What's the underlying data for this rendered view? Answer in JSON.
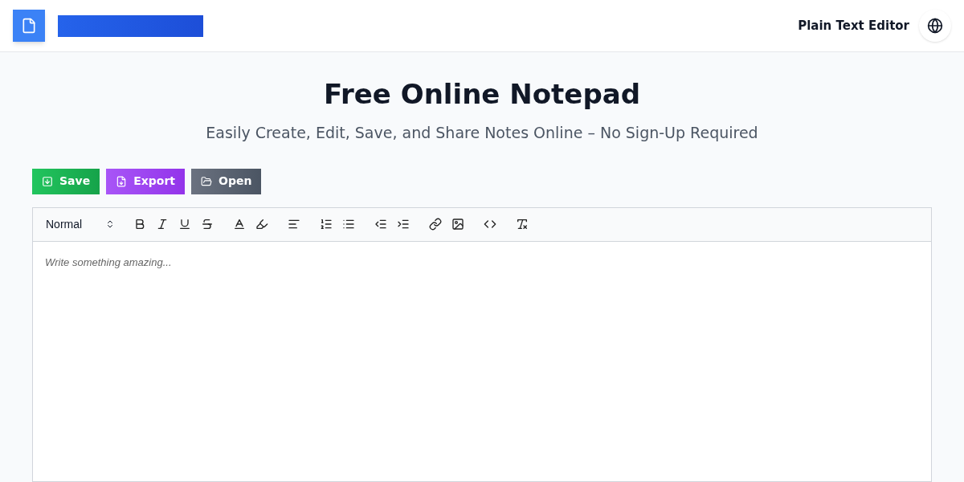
{
  "header": {
    "nav_link": "Plain Text Editor"
  },
  "hero": {
    "title": "Free Online Notepad",
    "subtitle": "Easily Create, Edit, Save, and Share Notes Online – No Sign-Up Required"
  },
  "actions": [
    {
      "label": "Save",
      "kind": "save",
      "color": "#16a34a"
    },
    {
      "label": "Export",
      "kind": "export",
      "color": "#9333ea"
    },
    {
      "label": "Open",
      "kind": "open",
      "color": "#4b5563"
    }
  ],
  "editor": {
    "format_select": "Normal",
    "placeholder": "Write something amazing..."
  }
}
